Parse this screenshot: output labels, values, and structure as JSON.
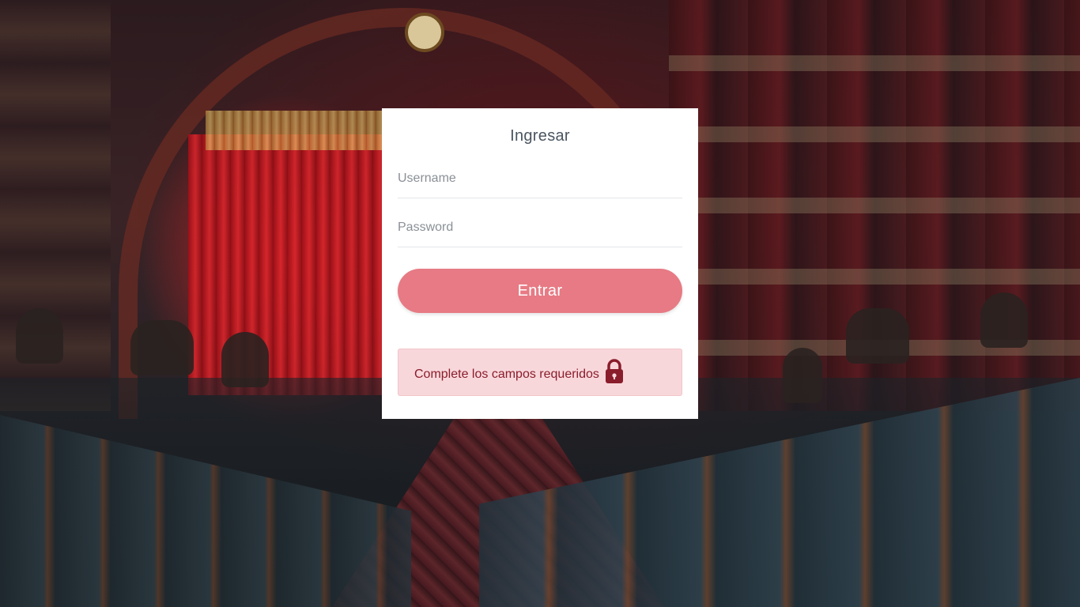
{
  "login": {
    "title": "Ingresar",
    "username_placeholder": "Username",
    "password_placeholder": "Password",
    "submit_label": "Entrar",
    "alert_message": "Complete los campos requeridos",
    "alert_icon": "lock-icon"
  },
  "colors": {
    "button": "#e77a84",
    "alert_background": "#f8d7db",
    "alert_text": "#8a1d2b"
  }
}
